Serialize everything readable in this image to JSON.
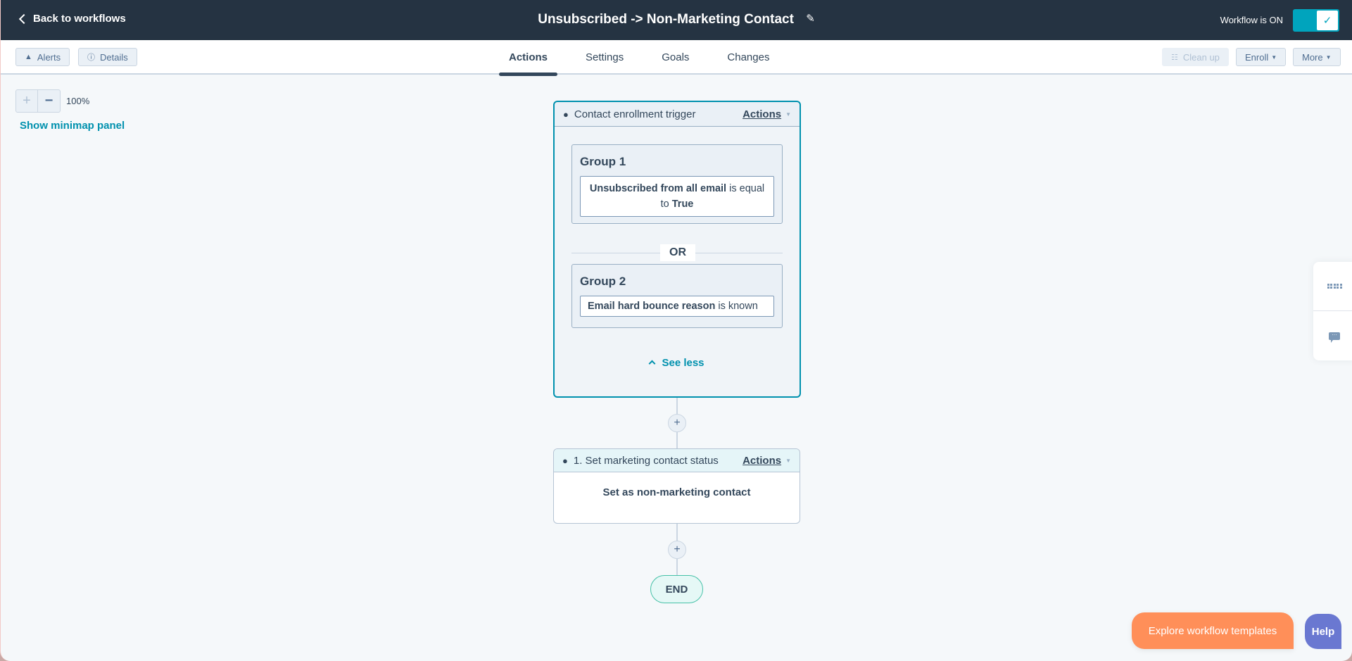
{
  "header": {
    "back_label": "Back to workflows",
    "title": "Unsubscribed -> Non-Marketing Contact",
    "status_label": "Workflow is ON",
    "toggle_on": true
  },
  "toolbar": {
    "alerts_label": "Alerts",
    "details_label": "Details",
    "cleanup_label": "Clean up",
    "enroll_label": "Enroll",
    "more_label": "More"
  },
  "tabs": [
    {
      "label": "Actions",
      "active": true
    },
    {
      "label": "Settings",
      "active": false
    },
    {
      "label": "Goals",
      "active": false
    },
    {
      "label": "Changes",
      "active": false
    }
  ],
  "canvas": {
    "zoom_level": "100%",
    "minimap_link": "Show minimap panel"
  },
  "trigger": {
    "title": "Contact enrollment trigger",
    "actions_label": "Actions",
    "groups": [
      {
        "title": "Group 1",
        "property": "Unsubscribed from all email",
        "operator": "is equal to",
        "value": "True"
      },
      {
        "title": "Group 2",
        "property": "Email hard bounce reason",
        "operator": "is known",
        "value": ""
      }
    ],
    "or_label": "OR",
    "see_less_label": "See less"
  },
  "action_step": {
    "title": "1. Set marketing contact status",
    "actions_label": "Actions",
    "body": "Set as non-marketing contact"
  },
  "end_label": "END",
  "floating": {
    "explore_label": "Explore workflow templates",
    "help_label": "Help"
  },
  "colors": {
    "header_bg": "#253342",
    "accent": "#0091ae",
    "toggle": "#00a4bd",
    "explore": "#ff8f59",
    "help": "#6a78d1",
    "end_border": "#45c1a7"
  }
}
